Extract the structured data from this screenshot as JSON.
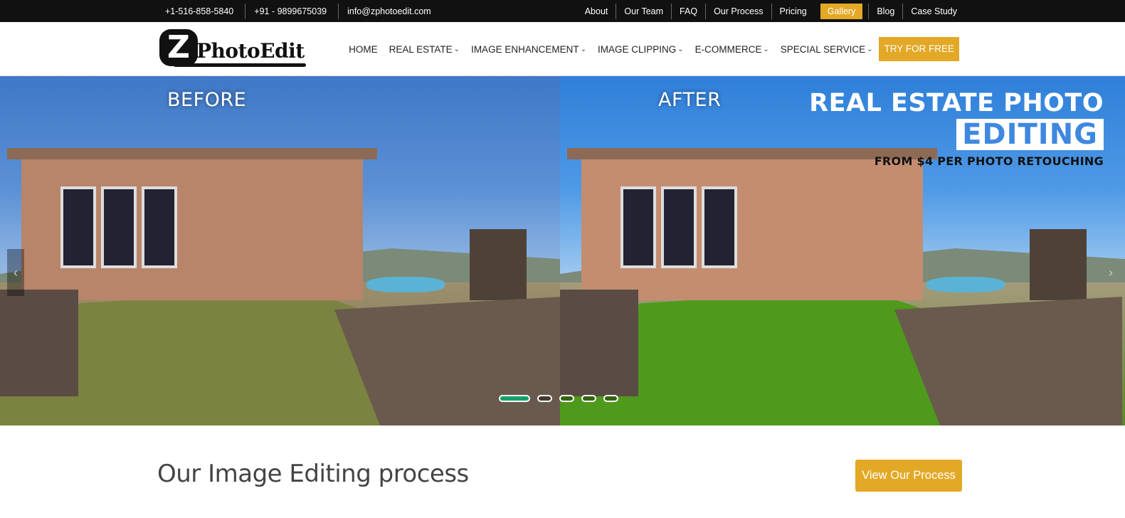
{
  "topbar": {
    "contacts": [
      "+1-516-858-5840",
      "+91 - 9899675039",
      "info@zphotoedit.com"
    ],
    "links": [
      "About",
      "Our Team",
      "FAQ",
      "Our Process",
      "Pricing",
      "Gallery",
      "Blog",
      "Case Study"
    ]
  },
  "header": {
    "logo_letter": "Z",
    "logo_name": "PhotoEdit",
    "nav": [
      "HOME",
      "REAL ESTATE",
      "IMAGE ENHANCEMENT",
      "IMAGE CLIPPING",
      "E-COMMERCE",
      "SPECIAL SERVICE"
    ],
    "cta": "TRY FOR FREE"
  },
  "hero": {
    "before_label": "BEFORE",
    "after_label": "AFTER",
    "promo_line1": "REAL ESTATE PHOTO",
    "promo_line2": "EDITING",
    "promo_line3": "FROM $4 PER PHOTO RETOUCHING",
    "prev_arrow": "‹",
    "next_arrow": "›",
    "slides_count": 5,
    "active_slide": 1
  },
  "process": {
    "title": "Our Image Editing process",
    "button": "View Our Process"
  },
  "colors": {
    "accent": "#e3a826",
    "topbar_bg": "#111111",
    "active_dot": "#14a06a",
    "promo_blue": "#3e88df"
  }
}
